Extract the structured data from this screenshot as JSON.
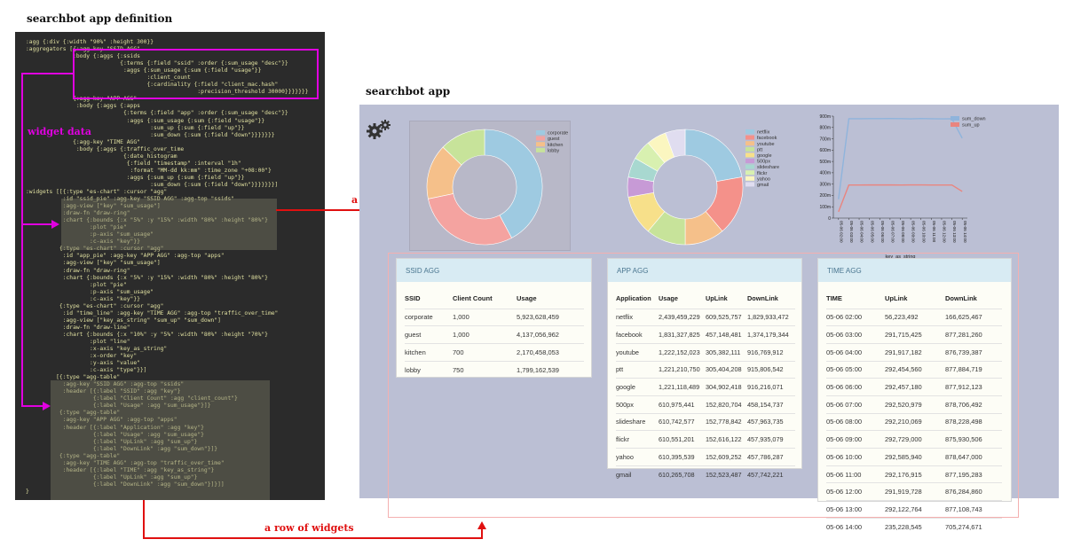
{
  "headings": {
    "definition": "searchbot app definition",
    "app": "searchbot app"
  },
  "annotations": {
    "widget_data": "widget data",
    "a_widget": "a widget",
    "row_of_widgets": "a row of widgets"
  },
  "code_text": ":agg {:div {:width \"90%\" :height 300}}\n:aggregators [{:agg-key \"SSID AGG\"\n              :body {:aggs {:ssids\n                            {:terms {:field \"ssid\" :order {:sum_usage \"desc\"}}\n                             :aggs {:sum_usage {:sum {:field \"usage\"}}\n                                    :client_count\n                                    {:cardinality {:field \"client_mac.hash\"\n                                                   :precision_threshold 30000}}}}}}}\n              {:agg-key \"APP AGG\"\n               :body {:aggs {:apps\n                             {:terms {:field \"app\" :order {:sum_usage \"desc\"}}\n                              :aggs {:sum_usage {:sum {:field \"usage\"}}\n                                     :sum_up {:sum {:field \"up\"}}\n                                     :sum_down {:sum {:field \"down\"}}}}}}}\n              {:agg-key \"TIME AGG\"\n               :body {:aggs {:traffic_over_time\n                             {:date_histogram\n                              {:field \"timestamp\" :interval \"1h\"\n                               :format \"MM-dd kk:mm\" :time_zone \"+08:00\"}\n                              :aggs {:sum_up {:sum {:field \"up\"}}\n                                     :sum_down {:sum {:field \"down\"}}}}}}}]\n:widgets [[{:type \"es-chart\" :cursor \"agg\"\n           :id \"ssid_pie\" :agg-key \"SSID AGG\" :agg-top \"ssids\"\n           :agg-view [\"key\" \"sum_usage\"]\n           :draw-fn \"draw-ring\"\n           :chart {:bounds {:x \"5%\" :y \"15%\" :width \"80%\" :height \"80%\"}\n                   :plot \"pie\"\n                   :p-axis \"sum_usage\"\n                   :c-axis \"key\"}}\n          {:type \"es-chart\" :cursor \"agg\"\n           :id \"app_pie\" :agg-key \"APP AGG\" :agg-top \"apps\"\n           :agg-view [\"key\" \"sum_usage\"]\n           :draw-fn \"draw-ring\"\n           :chart {:bounds {:x \"5%\" :y \"15%\" :width \"80%\" :height \"80%\"}\n                   :plot \"pie\"\n                   :p-axis \"sum_usage\"\n                   :c-axis \"key\"}}\n          {:type \"es-chart\" :cursor \"agg\"\n           :id \"time_line\" :agg-key \"TIME AGG\" :agg-top \"traffic_over_time\"\n           :agg-view [\"key_as_string\" \"sum_up\" \"sum_down\"]\n           :draw-fn \"draw-line\"\n           :chart {:bounds {:x \"10%\" :y \"5%\" :width \"80%\" :height \"70%\"}\n                   :plot \"line\"\n                   :x-axis \"key_as_string\"\n                   :x-order \"key\"\n                   :y-axis \"value\"\n                   :c-axis \"type\"}}]\n         [{:type \"agg-table\"\n           :agg-key \"SSID AGG\" :agg-top \"ssids\"\n           :header [{:label \"SSID\" :agg \"key\"}\n                    {:label \"Client Count\" :agg \"client_count\"}\n                    {:label \"Usage\" :agg \"sum_usage\"}]}\n          {:type \"agg-table\"\n           :agg-key \"APP AGG\" :agg-top \"apps\"\n           :header [{:label \"Application\" :agg \"key\"}\n                    {:label \"Usage\" :agg \"sum_usage\"}\n                    {:label \"UpLink\" :agg \"sum_up\"}\n                    {:label \"DownLink\" :agg \"sum_down\"}]}\n          {:type \"agg-table\"\n           :agg-key \"TIME AGG\" :agg-top \"traffic_over_time\"\n           :header [{:label \"TIME\" :agg \"key_as_string\"}\n                    {:label \"UpLink\" :agg \"sum_up\"}\n                    {:label \"DownLink\" :agg \"sum_down\"}]}]]\n}",
  "gear_icon": "gear-icon",
  "ssid_table": {
    "title": "SSID AGG",
    "headers": [
      "SSID",
      "Client Count",
      "Usage"
    ],
    "rows": [
      [
        "corporate",
        "1,000",
        "5,923,628,459"
      ],
      [
        "guest",
        "1,000",
        "4,137,056,962"
      ],
      [
        "kitchen",
        "700",
        "2,170,458,053"
      ],
      [
        "lobby",
        "750",
        "1,799,162,539"
      ]
    ]
  },
  "app_table": {
    "title": "APP AGG",
    "headers": [
      "Application",
      "Usage",
      "UpLink",
      "DownLink"
    ],
    "rows": [
      [
        "netflix",
        "2,439,459,229",
        "609,525,757",
        "1,829,933,472"
      ],
      [
        "facebook",
        "1,831,327,825",
        "457,148,481",
        "1,374,179,344"
      ],
      [
        "youtube",
        "1,222,152,023",
        "305,382,111",
        "916,769,912"
      ],
      [
        "ptt",
        "1,221,210,750",
        "305,404,208",
        "915,806,542"
      ],
      [
        "google",
        "1,221,118,489",
        "304,902,418",
        "916,216,071"
      ],
      [
        "500px",
        "610,975,441",
        "152,820,704",
        "458,154,737"
      ],
      [
        "slideshare",
        "610,742,577",
        "152,778,842",
        "457,963,735"
      ],
      [
        "flickr",
        "610,551,201",
        "152,616,122",
        "457,935,079"
      ],
      [
        "yahoo",
        "610,395,539",
        "152,609,252",
        "457,786,287"
      ],
      [
        "gmail",
        "610,265,708",
        "152,523,487",
        "457,742,221"
      ]
    ]
  },
  "time_table": {
    "title": "TIME AGG",
    "headers": [
      "TIME",
      "UpLink",
      "DownLink"
    ],
    "rows": [
      [
        "05-06 02:00",
        "56,223,492",
        "166,625,467"
      ],
      [
        "05-06 03:00",
        "291,715,425",
        "877,281,260"
      ],
      [
        "05-06 04:00",
        "291,917,182",
        "876,739,387"
      ],
      [
        "05-06 05:00",
        "292,454,560",
        "877,884,719"
      ],
      [
        "05-06 06:00",
        "292,457,180",
        "877,912,123"
      ],
      [
        "05-06 07:00",
        "292,520,979",
        "878,706,492"
      ],
      [
        "05-06 08:00",
        "292,210,069",
        "878,228,498"
      ],
      [
        "05-06 09:00",
        "292,729,000",
        "875,930,506"
      ],
      [
        "05-06 10:00",
        "292,585,940",
        "878,647,000"
      ],
      [
        "05-06 11:00",
        "292,176,915",
        "877,195,283"
      ],
      [
        "05-06 12:00",
        "291,919,728",
        "876,284,860"
      ],
      [
        "05-06 13:00",
        "292,122,764",
        "877,108,743"
      ],
      [
        "05-06 14:00",
        "235,228,545",
        "705,274,671"
      ]
    ]
  },
  "chart_data": [
    {
      "type": "pie",
      "categories": [
        "corporate",
        "guest",
        "kitchen",
        "lobby"
      ],
      "values": [
        5923628459,
        4137056962,
        2170458053,
        1799162539
      ],
      "colors": [
        "#9ecae1",
        "#f4a3a0",
        "#f5c08a",
        "#c7e39a"
      ],
      "legend": "top-right"
    },
    {
      "type": "pie",
      "categories": [
        "netflix",
        "facebook",
        "youtube",
        "ptt",
        "google",
        "500px",
        "slideshare",
        "flickr",
        "yahoo",
        "gmail"
      ],
      "values": [
        2439459229,
        1831327825,
        1222152023,
        1221210750,
        1221118489,
        610975441,
        610742577,
        610551201,
        610395539,
        610265708
      ],
      "colors": [
        "#9ecae1",
        "#f4918a",
        "#f5c08a",
        "#c7e39a",
        "#f7e08a",
        "#c79ad6",
        "#a8d8d0",
        "#d8f0b0",
        "#fbf6c0",
        "#e0ddf0"
      ],
      "legend": "top-right"
    },
    {
      "type": "line",
      "x": [
        "05-06 02:00",
        "05-06 03:00",
        "05-06 04:00",
        "05-06 05:00",
        "05-06 06:00",
        "05-06 07:00",
        "05-06 08:00",
        "05-06 09:00",
        "05-06 10:00",
        "05-06 11:00",
        "05-06 12:00",
        "05-06 13:00",
        "05-06 14:00"
      ],
      "series": [
        {
          "name": "sum_down",
          "color": "#8fb4dc",
          "values": [
            166.6,
            877.3,
            876.7,
            877.9,
            877.9,
            878.7,
            878.2,
            875.9,
            878.6,
            877.2,
            876.3,
            877.1,
            705.3
          ]
        },
        {
          "name": "sum_up",
          "color": "#e9857f",
          "values": [
            56.2,
            291.7,
            291.9,
            292.5,
            292.5,
            292.5,
            292.2,
            292.7,
            292.6,
            292.2,
            291.9,
            292.1,
            235.2
          ]
        }
      ],
      "yticks": [
        "0",
        "100m",
        "200m",
        "300m",
        "400m",
        "500m",
        "600m",
        "700m",
        "800m",
        "900m"
      ],
      "ylim": [
        0,
        900
      ],
      "xlabel": "key_as_string",
      "legend": "top-right"
    }
  ]
}
